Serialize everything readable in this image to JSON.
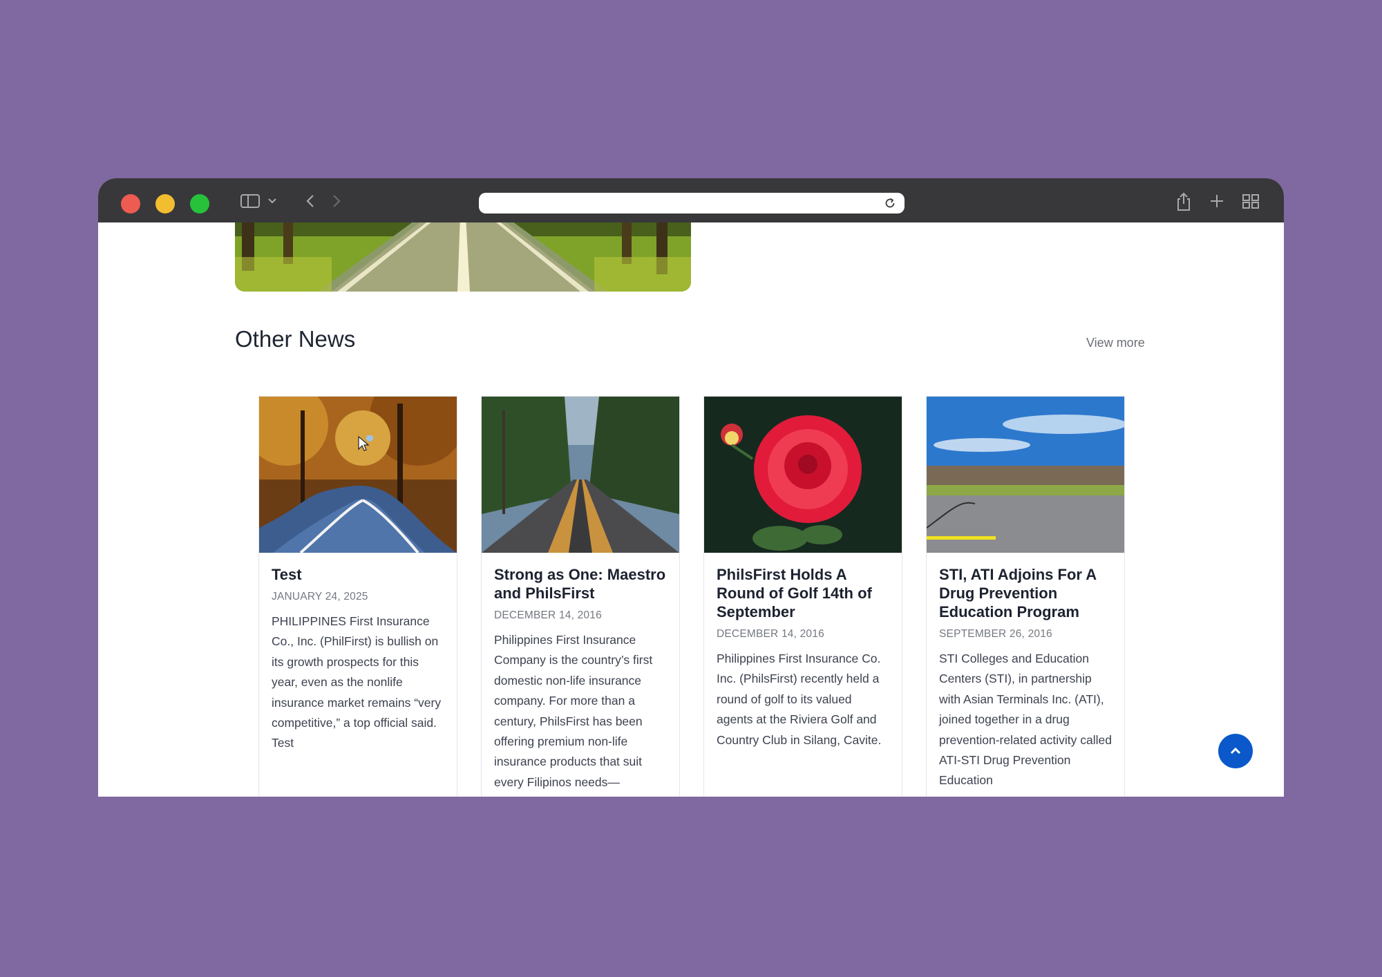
{
  "browser": {
    "address_value": "",
    "icons": [
      "sidebar-icon",
      "chevron-down-icon",
      "back-icon",
      "forward-icon",
      "reload-icon",
      "share-icon",
      "new-tab-icon",
      "tab-overview-icon"
    ],
    "traffic_light_colors": {
      "close": "#ee5b50",
      "minimize": "#f2bd2f",
      "zoom": "#27c23a"
    }
  },
  "section": {
    "title": "Other News",
    "view_more": "View more"
  },
  "news": [
    {
      "title": "Test",
      "date": "JANUARY 24, 2025",
      "excerpt": "PHILIPPINES First Insurance Co., Inc. (PhilFirst) is bullish on its growth prospects for this year, even as the nonlife insurance market remains “very competitive,” a top official said. Test"
    },
    {
      "title": "Strong as One: Maestro and PhilsFirst",
      "date": "DECEMBER 14, 2016",
      "excerpt": "Philippines First Insurance Company is the country’s first domestic non-life insurance company. For more than a century, PhilsFirst has been offering premium non-life insurance products that suit every Filipinos needs—"
    },
    {
      "title": "PhilsFirst Holds A Round of Golf 14th of September",
      "date": "DECEMBER 14, 2016",
      "excerpt": "Philippines First Insurance Co. Inc. (PhilsFirst) recently held a round of golf to its valued agents at the Riviera Golf and Country Club in Silang, Cavite."
    },
    {
      "title": "STI, ATI Adjoins For A Drug Prevention Education Program",
      "date": "SEPTEMBER 26, 2016",
      "excerpt": "STI Colleges and Education Centers (STI), in partnership with Asian Terminals Inc. (ATI), joined together in a drug prevention-related activity called ATI-STI Drug Prevention Education"
    }
  ],
  "colors": {
    "background": "#8068a0",
    "accent": "#0a58c9",
    "heading": "#1d2230"
  }
}
